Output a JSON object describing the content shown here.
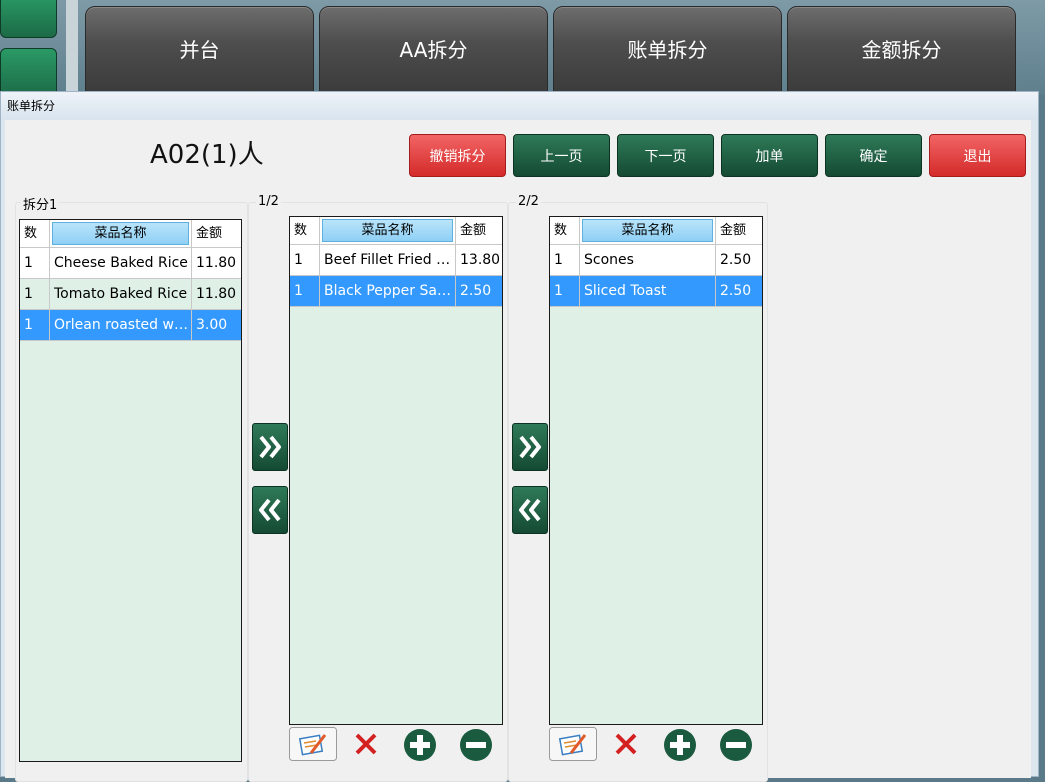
{
  "background": {
    "tabs": [
      "并台",
      "AA拆分",
      "账单拆分",
      "金额拆分"
    ]
  },
  "dialog": {
    "title": "账单拆分",
    "table_title": "A02(1)人",
    "buttons": {
      "undo_split": "撤销拆分",
      "prev_page": "上一页",
      "next_page": "下一页",
      "add_order": "加单",
      "confirm": "确定",
      "exit": "退出"
    },
    "columns": {
      "qty": "数",
      "name": "菜品名称",
      "amount": "金额"
    },
    "panel_source": {
      "label": "拆分1",
      "rows": [
        {
          "qty": "1",
          "name": "Cheese Baked Rice",
          "amount": "11.80",
          "state": "normal"
        },
        {
          "qty": "1",
          "name": "Tomato Baked Rice",
          "amount": "11.80",
          "state": "alt"
        },
        {
          "qty": "1",
          "name": "Orlean roasted wi...",
          "amount": "3.00",
          "state": "selected"
        }
      ]
    },
    "panel_split1": {
      "label": "1/2",
      "rows": [
        {
          "qty": "1",
          "name": "Beef Fillet Fried R...",
          "amount": "13.80",
          "state": "normal"
        },
        {
          "qty": "1",
          "name": "Black Pepper Sau...",
          "amount": "2.50",
          "state": "selected"
        }
      ]
    },
    "panel_split2": {
      "label": "2/2",
      "rows": [
        {
          "qty": "1",
          "name": "Scones",
          "amount": "2.50",
          "state": "normal"
        },
        {
          "qty": "1",
          "name": "Sliced Toast",
          "amount": "2.50",
          "state": "selected"
        }
      ]
    },
    "colors": {
      "accent_green": "#144a33",
      "danger_red": "#d42a2a",
      "selection_blue": "#3399ff",
      "grid_bg": "#dff1e6"
    }
  }
}
